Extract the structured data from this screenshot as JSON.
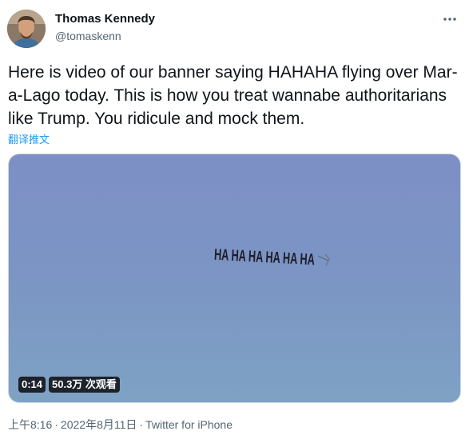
{
  "author": {
    "name": "Thomas Kennedy",
    "handle": "@tomaskenn"
  },
  "tweet": {
    "text": "Here is video of our banner saying HAHAHA flying over Mar-a-Lago today. This is how you treat wannabe authoritarians like Trump. You ridicule and mock them.",
    "translate_label": "翻译推文"
  },
  "media": {
    "banner_text": "HA HA HA HA HA HA",
    "duration": "0:14",
    "views": "50.3万 次观看"
  },
  "footer": {
    "time": "上午8:16",
    "date": "2022年8月11日",
    "separator": "·",
    "source": "Twitter for iPhone"
  },
  "icons": {
    "more": "more-horizontal-icon"
  },
  "colors": {
    "link": "#1d9bf0",
    "secondary_text": "#536471",
    "sky": "#7c92c4"
  }
}
